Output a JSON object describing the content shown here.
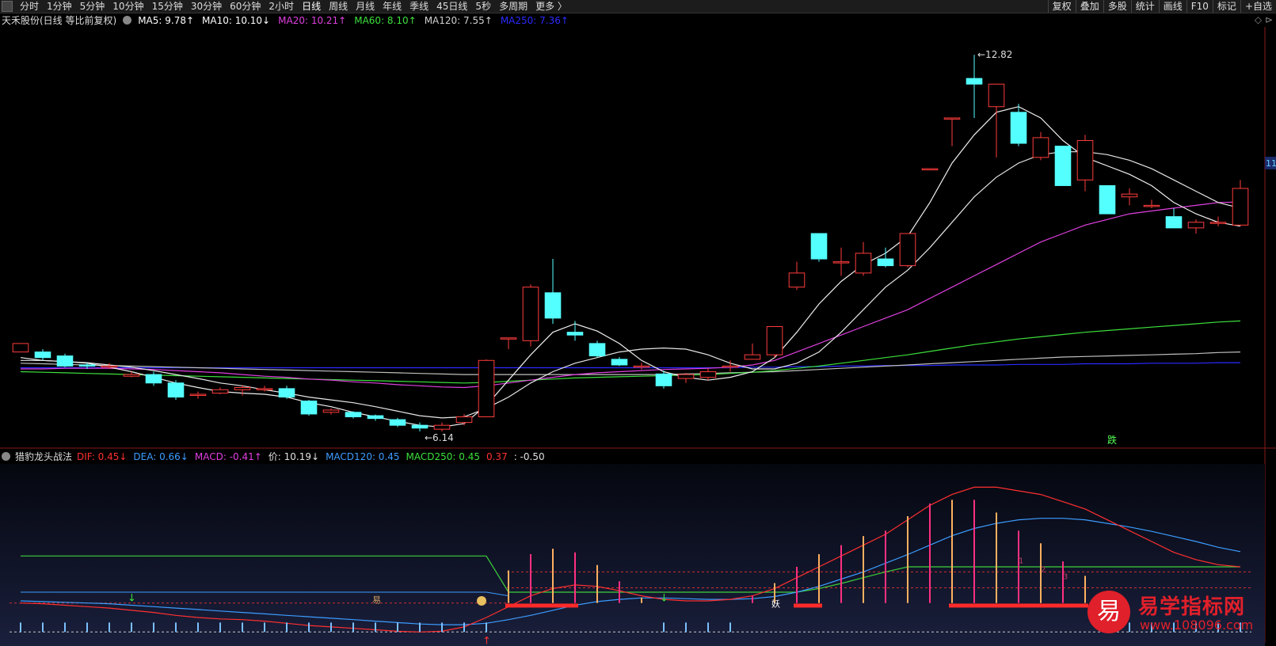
{
  "toolbar": {
    "tabs": [
      "分时",
      "1分钟",
      "5分钟",
      "10分钟",
      "15分钟",
      "30分钟",
      "60分钟",
      "2小时",
      "日线",
      "周线",
      "月线",
      "年线",
      "季线",
      "45日线",
      "5秒",
      "多周期",
      "更多"
    ],
    "active_tab": "日线",
    "right_buttons": [
      "复权",
      "叠加",
      "多股",
      "统计",
      "画线",
      "F10",
      "标记",
      "+自选"
    ]
  },
  "main_legend": {
    "title": "天禾股份(日线 等比前复权)",
    "ma": [
      {
        "label": "MA5: 9.78↑",
        "color": "#ffffff"
      },
      {
        "label": "MA10: 10.10↓",
        "color": "#ffffff"
      },
      {
        "label": "MA20: 10.21↑",
        "color": "#e040e0"
      },
      {
        "label": "MA60: 8.10↑",
        "color": "#3ce03c"
      },
      {
        "label": "MA120: 7.55↑",
        "color": "#d0d0d0"
      },
      {
        "label": "MA250: 7.36↑",
        "color": "#2a2aff"
      }
    ]
  },
  "sub_legend": {
    "title": "猎豹龙头战法",
    "items": [
      {
        "label": "DIF: 0.45↓",
        "color": "#ff3030"
      },
      {
        "label": "DEA: 0.66↓",
        "color": "#3c9cff"
      },
      {
        "label": "MACD: -0.41↑",
        "color": "#e040e0"
      },
      {
        "label": "价: 10.19↓",
        "color": "#e0e0e0"
      },
      {
        "label": "MACD120: 0.45",
        "color": "#3c9cff"
      },
      {
        "label": "MACD250: 0.45",
        "color": "#3ce03c"
      },
      {
        "label": "0.37",
        "color": "#ff3030"
      },
      {
        "label": ": -0.50",
        "color": "#e0e0e0"
      }
    ]
  },
  "corner_label": "◇ ⊳",
  "right_price_tag": "11.",
  "chart_data": {
    "type": "candlestick",
    "high_label": "12.82",
    "low_label": "6.14",
    "annotation_fall": "跌",
    "sub_markers": [
      "易",
      "妖",
      "1",
      "2",
      "3"
    ],
    "candles": [
      {
        "o": 7.55,
        "c": 7.7,
        "h": 7.7,
        "l": 7.55
      },
      {
        "o": 7.55,
        "c": 7.45,
        "h": 7.6,
        "l": 7.4
      },
      {
        "o": 7.48,
        "c": 7.3,
        "h": 7.52,
        "l": 7.28
      },
      {
        "o": 7.32,
        "c": 7.3,
        "h": 7.36,
        "l": 7.25
      },
      {
        "o": 7.3,
        "c": 7.3,
        "h": 7.35,
        "l": 7.25
      },
      {
        "o": 7.12,
        "c": 7.15,
        "h": 7.2,
        "l": 7.1
      },
      {
        "o": 7.15,
        "c": 7.0,
        "h": 7.2,
        "l": 6.95
      },
      {
        "o": 7.0,
        "c": 6.75,
        "h": 7.05,
        "l": 6.7
      },
      {
        "o": 6.78,
        "c": 6.8,
        "h": 6.85,
        "l": 6.72
      },
      {
        "o": 6.82,
        "c": 6.88,
        "h": 6.92,
        "l": 6.8
      },
      {
        "o": 6.88,
        "c": 6.92,
        "h": 6.96,
        "l": 6.78
      },
      {
        "o": 6.9,
        "c": 6.9,
        "h": 6.95,
        "l": 6.85
      },
      {
        "o": 6.9,
        "c": 6.75,
        "h": 6.95,
        "l": 6.72
      },
      {
        "o": 6.68,
        "c": 6.45,
        "h": 6.7,
        "l": 6.42
      },
      {
        "o": 6.48,
        "c": 6.52,
        "h": 6.55,
        "l": 6.44
      },
      {
        "o": 6.48,
        "c": 6.4,
        "h": 6.5,
        "l": 6.37
      },
      {
        "o": 6.42,
        "c": 6.37,
        "h": 6.44,
        "l": 6.33
      },
      {
        "o": 6.35,
        "c": 6.25,
        "h": 6.38,
        "l": 6.22
      },
      {
        "o": 6.25,
        "c": 6.2,
        "h": 6.3,
        "l": 6.14
      },
      {
        "o": 6.18,
        "c": 6.25,
        "h": 6.3,
        "l": 6.14
      },
      {
        "o": 6.3,
        "c": 6.4,
        "h": 6.45,
        "l": 6.25
      },
      {
        "o": 6.4,
        "c": 7.4,
        "h": 7.42,
        "l": 6.4
      },
      {
        "o": 7.8,
        "c": 7.8,
        "h": 7.8,
        "l": 7.6
      },
      {
        "o": 7.75,
        "c": 8.7,
        "h": 8.75,
        "l": 7.65
      },
      {
        "o": 8.6,
        "c": 8.15,
        "h": 9.2,
        "l": 8.05
      },
      {
        "o": 7.9,
        "c": 7.85,
        "h": 8.1,
        "l": 7.75
      },
      {
        "o": 7.7,
        "c": 7.48,
        "h": 7.75,
        "l": 7.45
      },
      {
        "o": 7.42,
        "c": 7.32,
        "h": 7.46,
        "l": 7.3
      },
      {
        "o": 7.3,
        "c": 7.3,
        "h": 7.36,
        "l": 7.24
      },
      {
        "o": 7.16,
        "c": 6.95,
        "h": 7.22,
        "l": 6.9
      },
      {
        "o": 7.08,
        "c": 7.15,
        "h": 7.18,
        "l": 7.0
      },
      {
        "o": 7.1,
        "c": 7.2,
        "h": 7.26,
        "l": 7.05
      },
      {
        "o": 7.28,
        "c": 7.3,
        "h": 7.4,
        "l": 7.2
      },
      {
        "o": 7.42,
        "c": 7.5,
        "h": 7.7,
        "l": 7.45
      },
      {
        "o": 7.5,
        "c": 8.0,
        "h": 8.0,
        "l": 7.45
      },
      {
        "o": 8.7,
        "c": 8.95,
        "h": 9.15,
        "l": 8.65
      },
      {
        "o": 9.65,
        "c": 9.2,
        "h": 9.65,
        "l": 9.15
      },
      {
        "o": 9.15,
        "c": 9.15,
        "h": 9.4,
        "l": 8.9
      },
      {
        "o": 8.95,
        "c": 9.3,
        "h": 9.5,
        "l": 8.9
      },
      {
        "o": 9.2,
        "c": 9.08,
        "h": 9.4,
        "l": 9.05
      },
      {
        "o": 9.08,
        "c": 9.65,
        "h": 9.65,
        "l": 9.05
      },
      {
        "o": 10.8,
        "c": 10.8,
        "h": 10.8,
        "l": 10.8
      },
      {
        "o": 11.7,
        "c": 11.7,
        "h": 11.7,
        "l": 11.2
      },
      {
        "o": 12.4,
        "c": 12.3,
        "h": 12.82,
        "l": 11.7
      },
      {
        "o": 11.9,
        "c": 12.3,
        "h": 12.3,
        "l": 11.0
      },
      {
        "o": 11.8,
        "c": 11.25,
        "h": 11.95,
        "l": 11.2
      },
      {
        "o": 11.0,
        "c": 11.35,
        "h": 11.45,
        "l": 10.95
      },
      {
        "o": 11.2,
        "c": 10.5,
        "h": 11.2,
        "l": 10.5
      },
      {
        "o": 10.6,
        "c": 11.3,
        "h": 11.4,
        "l": 10.4
      },
      {
        "o": 10.5,
        "c": 10.0,
        "h": 10.5,
        "l": 10.0
      },
      {
        "o": 10.3,
        "c": 10.35,
        "h": 10.45,
        "l": 10.15
      },
      {
        "o": 10.15,
        "c": 10.15,
        "h": 10.25,
        "l": 10.1
      },
      {
        "o": 9.95,
        "c": 9.75,
        "h": 10.1,
        "l": 9.75
      },
      {
        "o": 9.75,
        "c": 9.85,
        "h": 9.9,
        "l": 9.65
      },
      {
        "o": 9.85,
        "c": 9.85,
        "h": 9.95,
        "l": 9.78
      },
      {
        "o": 9.8,
        "c": 10.45,
        "h": 10.6,
        "l": 9.78
      }
    ],
    "ma5": [
      7.45,
      7.4,
      7.38,
      7.35,
      7.28,
      7.2,
      7.1,
      7.0,
      6.92,
      6.85,
      6.82,
      6.8,
      6.75,
      6.65,
      6.58,
      6.48,
      6.4,
      6.32,
      6.25,
      6.22,
      6.28,
      6.6,
      7.05,
      7.5,
      7.9,
      8.05,
      7.92,
      7.7,
      7.4,
      7.2,
      7.1,
      7.05,
      7.1,
      7.2,
      7.45,
      7.9,
      8.4,
      8.8,
      9.1,
      9.3,
      9.6,
      10.2,
      10.9,
      11.4,
      11.8,
      11.9,
      11.7,
      11.3,
      11.0,
      10.85,
      10.7,
      10.5,
      10.2,
      10.0,
      9.85,
      9.78
    ],
    "ma10": [
      7.4,
      7.4,
      7.38,
      7.36,
      7.32,
      7.28,
      7.22,
      7.15,
      7.08,
      7.0,
      6.95,
      6.88,
      6.82,
      6.75,
      6.7,
      6.65,
      6.58,
      6.5,
      6.42,
      6.38,
      6.4,
      6.55,
      6.75,
      7.0,
      7.2,
      7.35,
      7.45,
      7.55,
      7.6,
      7.62,
      7.6,
      7.5,
      7.35,
      7.25,
      7.25,
      7.35,
      7.55,
      7.9,
      8.3,
      8.7,
      9.0,
      9.4,
      9.85,
      10.3,
      10.65,
      10.9,
      11.05,
      11.1,
      11.1,
      11.05,
      10.95,
      10.8,
      10.6,
      10.4,
      10.2,
      10.1
    ],
    "ma20": [
      7.25,
      7.25,
      7.26,
      7.26,
      7.26,
      7.25,
      7.24,
      7.22,
      7.2,
      7.18,
      7.15,
      7.12,
      7.1,
      7.07,
      7.05,
      7.02,
      7.0,
      6.97,
      6.95,
      6.93,
      6.92,
      6.95,
      7.0,
      7.05,
      7.1,
      7.15,
      7.18,
      7.2,
      7.22,
      7.24,
      7.25,
      7.26,
      7.28,
      7.32,
      7.4,
      7.55,
      7.7,
      7.85,
      8.0,
      8.15,
      8.3,
      8.5,
      8.7,
      8.9,
      9.1,
      9.3,
      9.5,
      9.65,
      9.8,
      9.9,
      10.0,
      10.05,
      10.1,
      10.15,
      10.2,
      10.21
    ],
    "ma60": [
      7.2,
      7.19,
      7.18,
      7.17,
      7.16,
      7.15,
      7.14,
      7.13,
      7.12,
      7.11,
      7.1,
      7.09,
      7.08,
      7.07,
      7.06,
      7.05,
      7.04,
      7.03,
      7.02,
      7.01,
      7.0,
      7.01,
      7.03,
      7.05,
      7.07,
      7.09,
      7.1,
      7.11,
      7.12,
      7.13,
      7.14,
      7.15,
      7.17,
      7.19,
      7.22,
      7.26,
      7.3,
      7.35,
      7.4,
      7.45,
      7.5,
      7.56,
      7.62,
      7.68,
      7.73,
      7.78,
      7.82,
      7.86,
      7.9,
      7.93,
      7.96,
      7.99,
      8.02,
      8.05,
      8.08,
      8.1
    ],
    "ma120": [
      7.35,
      7.34,
      7.33,
      7.32,
      7.31,
      7.3,
      7.29,
      7.28,
      7.27,
      7.26,
      7.25,
      7.24,
      7.23,
      7.22,
      7.21,
      7.2,
      7.19,
      7.18,
      7.17,
      7.16,
      7.15,
      7.15,
      7.15,
      7.15,
      7.15,
      7.15,
      7.15,
      7.15,
      7.15,
      7.15,
      7.16,
      7.17,
      7.18,
      7.19,
      7.2,
      7.22,
      7.24,
      7.26,
      7.28,
      7.3,
      7.32,
      7.34,
      7.36,
      7.38,
      7.4,
      7.42,
      7.44,
      7.46,
      7.47,
      7.48,
      7.49,
      7.5,
      7.51,
      7.52,
      7.54,
      7.55
    ],
    "ma250": [
      7.27,
      7.27,
      7.27,
      7.27,
      7.27,
      7.27,
      7.27,
      7.27,
      7.27,
      7.27,
      7.27,
      7.27,
      7.27,
      7.27,
      7.27,
      7.27,
      7.27,
      7.27,
      7.27,
      7.27,
      7.27,
      7.27,
      7.27,
      7.27,
      7.27,
      7.27,
      7.27,
      7.27,
      7.27,
      7.27,
      7.27,
      7.27,
      7.27,
      7.28,
      7.28,
      7.29,
      7.29,
      7.3,
      7.3,
      7.31,
      7.31,
      7.31,
      7.32,
      7.32,
      7.32,
      7.33,
      7.33,
      7.33,
      7.34,
      7.34,
      7.34,
      7.35,
      7.35,
      7.35,
      7.36,
      7.36
    ],
    "y_range": [
      6.0,
      13.3
    ],
    "sub_indicator": {
      "dif": [
        -0.05,
        -0.06,
        -0.08,
        -0.1,
        -0.12,
        -0.15,
        -0.18,
        -0.22,
        -0.25,
        -0.27,
        -0.28,
        -0.3,
        -0.33,
        -0.36,
        -0.38,
        -0.4,
        -0.42,
        -0.44,
        -0.45,
        -0.44,
        -0.38,
        -0.25,
        -0.1,
        0.05,
        0.15,
        0.2,
        0.18,
        0.12,
        0.05,
        0.0,
        -0.02,
        -0.02,
        0.0,
        0.05,
        0.15,
        0.3,
        0.45,
        0.6,
        0.75,
        0.9,
        1.1,
        1.3,
        1.45,
        1.55,
        1.55,
        1.5,
        1.45,
        1.35,
        1.25,
        1.1,
        0.95,
        0.8,
        0.65,
        0.55,
        0.48,
        0.45
      ],
      "dea": [
        -0.02,
        -0.03,
        -0.04,
        -0.05,
        -0.06,
        -0.08,
        -0.1,
        -0.12,
        -0.14,
        -0.16,
        -0.18,
        -0.2,
        -0.22,
        -0.24,
        -0.26,
        -0.28,
        -0.3,
        -0.32,
        -0.34,
        -0.35,
        -0.35,
        -0.33,
        -0.28,
        -0.22,
        -0.15,
        -0.08,
        -0.03,
        0.0,
        0.02,
        0.02,
        0.01,
        0.0,
        0.0,
        0.01,
        0.04,
        0.1,
        0.18,
        0.28,
        0.38,
        0.5,
        0.62,
        0.75,
        0.88,
        0.98,
        1.05,
        1.1,
        1.12,
        1.12,
        1.1,
        1.05,
        1.0,
        0.94,
        0.87,
        0.8,
        0.72,
        0.66
      ],
      "ma250_line": [
        0.6,
        0.6,
        0.6,
        0.6,
        0.6,
        0.6,
        0.6,
        0.6,
        0.6,
        0.6,
        0.6,
        0.6,
        0.6,
        0.6,
        0.6,
        0.6,
        0.6,
        0.6,
        0.6,
        0.6,
        0.6,
        0.6,
        0.1,
        0.1,
        0.1,
        0.1,
        0.1,
        0.1,
        0.1,
        0.1,
        0.1,
        0.1,
        0.1,
        0.1,
        0.1,
        0.1,
        0.15,
        0.22,
        0.3,
        0.38,
        0.45,
        0.45,
        0.45,
        0.45,
        0.45,
        0.45,
        0.45,
        0.45,
        0.45,
        0.45,
        0.45,
        0.45,
        0.45,
        0.45,
        0.45,
        0.45
      ],
      "y_range": [
        -0.6,
        1.85
      ]
    }
  }
}
